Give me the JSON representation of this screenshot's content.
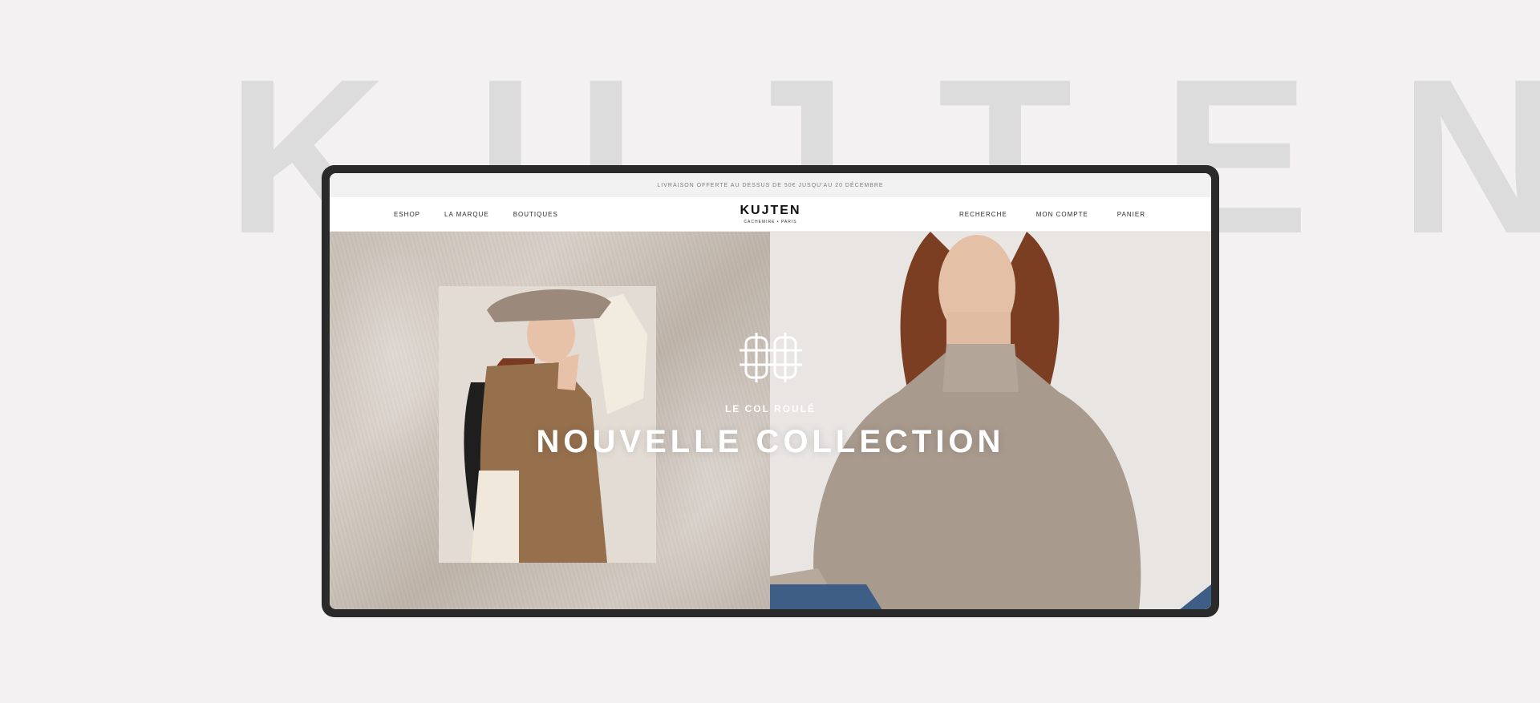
{
  "background_word": "KUJTEN",
  "promo": {
    "text": "LIVRAISON OFFERTE AU DESSUS DE 50€ JUSQU'AU 20 DÉCEMBRE"
  },
  "nav": {
    "left": [
      "ESHOP",
      "LA MARQUE",
      "BOUTIQUES"
    ],
    "right": [
      "RECHERCHE",
      "MON COMPTE",
      "PANIER"
    ]
  },
  "brand": {
    "name": "KUJTEN",
    "tagline": "CACHEMIRE • PARIS"
  },
  "hero": {
    "subtitle": "LE COL ROULÉ",
    "title": "NOUVELLE COLLECTION",
    "emblem_icon": "knot-monogram-icon"
  },
  "colors": {
    "page_background": "#f3f1f2",
    "background_word": "#dcdcdc",
    "device_frame": "#2a2a2a",
    "hero_text": "#ffffff"
  }
}
